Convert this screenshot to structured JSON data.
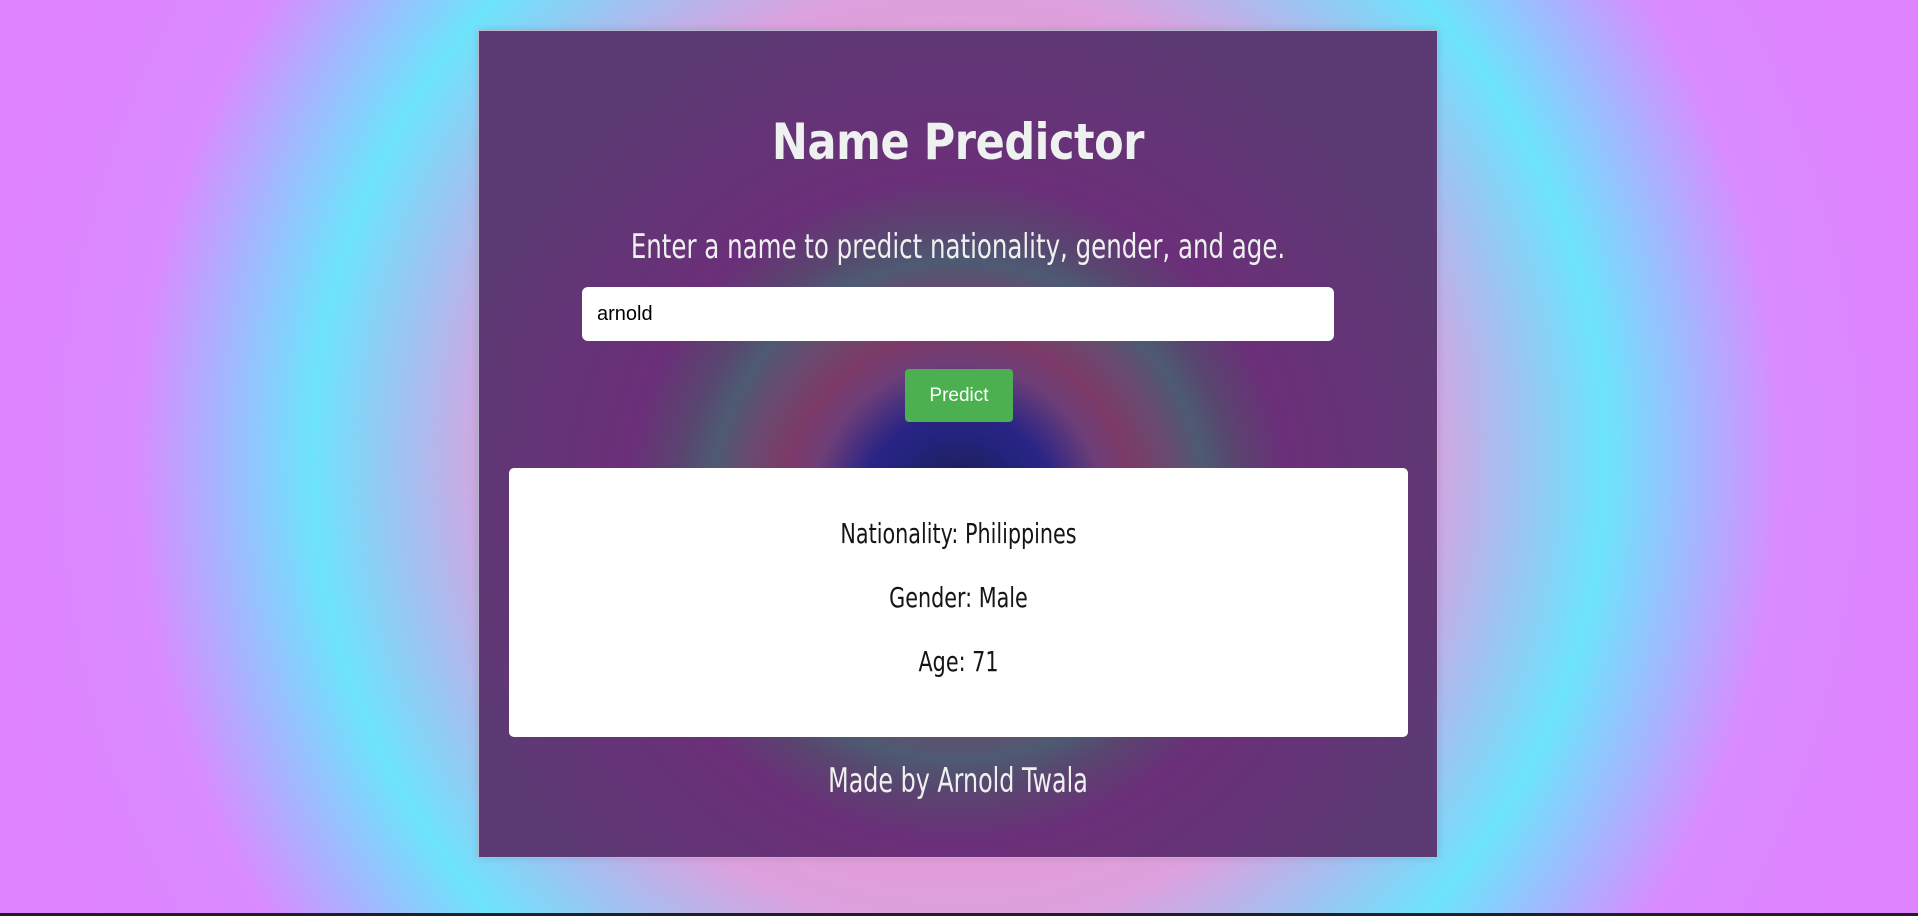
{
  "app": {
    "title": "Name Predictor",
    "subtitle": "Enter a name to predict nationality, gender, and age."
  },
  "form": {
    "input_value": "arnold",
    "button_label": "Predict"
  },
  "results": {
    "nationality": "Nationality: Philippines",
    "gender": "Gender: Male",
    "age": "Age: 71"
  },
  "footer": {
    "text": "Made by Arnold Twala"
  },
  "colors": {
    "button": "#4caf50",
    "text_light": "#eef1ef",
    "panel": "#ffffff"
  }
}
